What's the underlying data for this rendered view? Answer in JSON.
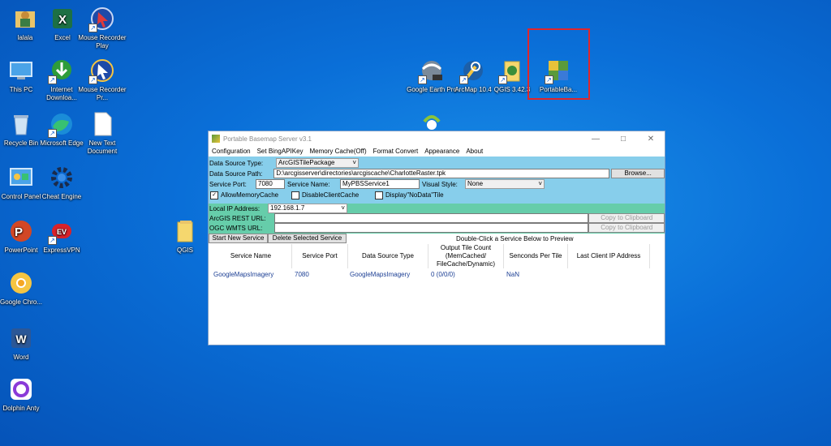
{
  "desktop": {
    "icons": [
      {
        "label": "lalala"
      },
      {
        "label": "Excel"
      },
      {
        "label": "Mouse Recorder Play"
      },
      {
        "label": "This PC"
      },
      {
        "label": "Internet Downloa..."
      },
      {
        "label": "Mouse Recorder Pr..."
      },
      {
        "label": "Recycle Bin"
      },
      {
        "label": "Microsoft Edge"
      },
      {
        "label": "New Text Document"
      },
      {
        "label": "Control Panel"
      },
      {
        "label": "Cheat Engine"
      },
      {
        "label": "PowerPoint"
      },
      {
        "label": "ExpressVPN"
      },
      {
        "label": "Google Chro..."
      },
      {
        "label": "Word"
      },
      {
        "label": "Dolphin Anty"
      },
      {
        "label": "QGIS"
      },
      {
        "label": "Google Earth Pro"
      },
      {
        "label": "ArcMap 10.4"
      },
      {
        "label": "QGIS 3.42.3"
      },
      {
        "label": "PortableBa..."
      },
      {
        "label": ""
      }
    ]
  },
  "window": {
    "title": "Portable Basemap Server v3.1",
    "menu": [
      "Configuration",
      "Set BingAPIKey",
      "Memory Cache(Off)",
      "Format Convert",
      "Appearance",
      "About"
    ],
    "data_source_type_label": "Data Source Type:",
    "data_source_type_value": "ArcGISTilePackage",
    "data_source_path_label": "Data Source Path:",
    "data_source_path_value": "D:\\arcgisserver\\directories\\arcgiscache\\CharlotteRaster.tpk",
    "browse_label": "Browse...",
    "service_port_label": "Service Port:",
    "service_port_value": "7080",
    "service_name_label": "Service Name:",
    "service_name_value": "MyPBSService1",
    "visual_style_label": "Visual Style:",
    "visual_style_value": "None",
    "allow_memory_cache": "AllowMemoryCache",
    "disable_client_cache": "DisableClientCache",
    "display_nodata_tile": "Display\"NoData\"Tile",
    "local_ip_label": "Local IP Address:",
    "local_ip_value": "192.168.1.7",
    "arcgis_rest_label": "ArcGIS REST URL:",
    "ogc_wmts_label": "OGC WMTS URL:",
    "copy_clipboard": "Copy to Clipboard",
    "start_service": "Start New Service",
    "delete_service": "Delete Selected Service",
    "hint": "Double-Click a Service Below to Preview",
    "columns": [
      "Service Name",
      "Service Port",
      "Data Source Type",
      "Output Tile Count (MemCached/ FileCache/Dynamic)",
      "Senconds Per Tile",
      "Last Client IP Address"
    ],
    "rows": [
      [
        "GoogleMapsImagery",
        "7080",
        "GoogleMapsImagery",
        "0 (0/0/0)",
        "NaN",
        ""
      ]
    ]
  },
  "colors": {
    "accent_blue": "#87ceeb",
    "accent_green": "#66cdaa",
    "selection_red": "#e0262b"
  }
}
